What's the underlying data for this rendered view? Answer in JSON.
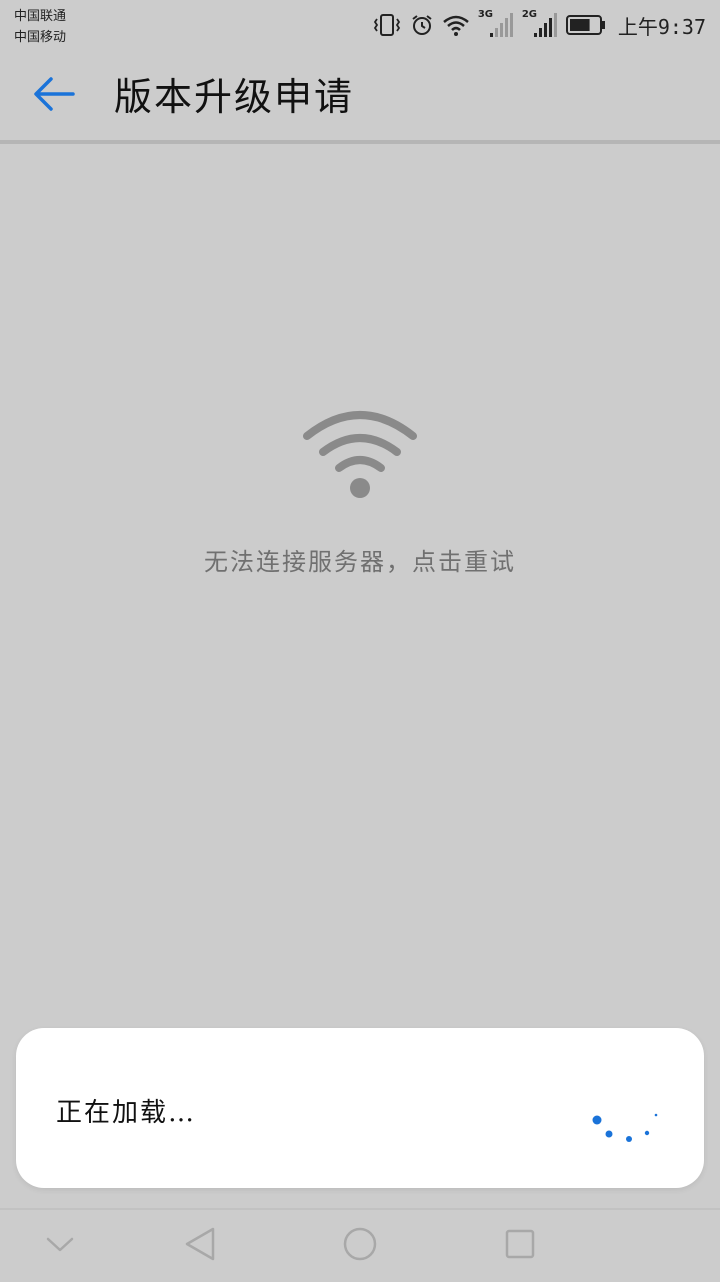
{
  "status_bar": {
    "carrier_1": "中国联通",
    "carrier_2": "中国移动",
    "network_1": "3G",
    "network_2": "2G",
    "time": "上午9:37",
    "battery_level": 0.7
  },
  "app_bar": {
    "title": "版本升级申请",
    "back_icon": "arrow-left-icon",
    "accent_color": "#1a73d9"
  },
  "error_state": {
    "icon": "wifi-icon",
    "message": "无法连接服务器，点击重试"
  },
  "loading_dialog": {
    "text": "正在加载…",
    "spinner_color": "#1a73d9"
  },
  "nav_bar": {
    "buttons": [
      "collapse-icon",
      "back-triangle-icon",
      "home-circle-icon",
      "recents-square-icon"
    ]
  }
}
